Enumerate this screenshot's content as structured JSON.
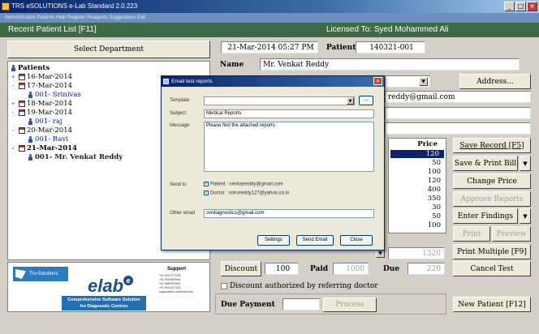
{
  "window": {
    "title": "TRS eSOLUTIONS e-Lab Standard 2.0.223"
  },
  "menubar": {
    "text": "Administration  Patients  Help  Register Reagents  Suggestions  Exit"
  },
  "header": {
    "left": "Recent Patient List [F11]",
    "right": "Licensed To: Syed Mohammed Ali"
  },
  "left_panel": {
    "select_department": "Select Department",
    "tree": [
      {
        "type": "root",
        "label": "Patients"
      },
      {
        "type": "date",
        "label": "16-Mar-2014",
        "bold": false
      },
      {
        "type": "date",
        "label": "17-Mar-2014",
        "bold": false
      },
      {
        "type": "patient",
        "label": "001- Srinivas"
      },
      {
        "type": "date",
        "label": "18-Mar-2014",
        "bold": false
      },
      {
        "type": "date",
        "label": "19-Mar-2014",
        "bold": false
      },
      {
        "type": "patient",
        "label": "001- raj"
      },
      {
        "type": "date",
        "label": "20-Mar-2014",
        "bold": false
      },
      {
        "type": "patient",
        "label": "001- Ravi"
      },
      {
        "type": "date",
        "label": "21-Mar-2014",
        "bold": true
      },
      {
        "type": "patient",
        "label": "001- Mr. Venkat Reddy"
      }
    ],
    "logo": {
      "brand": "Tru-Solutions",
      "product": "elab",
      "product_mark": "e",
      "tagline_1": "Comprehensive Software Solution",
      "tagline_2": "for Diagnostic Centres",
      "support_title": "Support",
      "support_lines": [
        "+91 9014770725",
        "+91 9394590944",
        "+91 9869370500",
        "+91 9014477244",
        "support@tru-solutions.com"
      ]
    }
  },
  "patient": {
    "datetime": "21-Mar-2014 05:27 PM",
    "patient_id_label": "Patient Id",
    "patient_id": "140321-001",
    "name_label": "Name",
    "name": "Mr. Venkat Reddy",
    "email_visible": "reddy@gmail.com",
    "address_button": "Address..."
  },
  "tests": {
    "price_header": "Price",
    "prices": [
      "120",
      "50",
      "100",
      "120",
      "400",
      "350",
      "30",
      "50",
      "100"
    ],
    "right_value": "1320"
  },
  "actions": {
    "save_record": "Save Record [F5]",
    "save_print_bill": "Save & Print Bill",
    "change_price": "Change Price",
    "approve_reports": "Approve Reports",
    "enter_findings": "Enter Findings",
    "print": "Print",
    "preview": "Preview",
    "print_multiple": "Print Multiple [F9]",
    "cancel_test": "Cancel Test",
    "new_patient": "New Patient [F12]"
  },
  "billing": {
    "discount_label": "Discount",
    "discount_value": "100",
    "paid_label": "Paid",
    "paid_value": "1000",
    "due_label": "Due",
    "due_value": "220",
    "discount_auth": "Discount authorized by referring doctor",
    "due_payment_label": "Due Payment",
    "process_button": "Process"
  },
  "email_dialog": {
    "title": "Email test reports",
    "template_label": "Template",
    "browse": "...",
    "subject_label": "Subject",
    "subject_value": "Medical Reports",
    "message_label": "Message",
    "message_value": "Please find the attached reports",
    "send_to_label": "Send to",
    "patient_option": "Patient : venkatreddy@gmail.com",
    "doctor_option": "Doctor : srinureddy127@yahoo.co.in",
    "other_email_label": "Other email",
    "other_email_value": "svrdiagnostics@gmail.com",
    "settings": "Settings",
    "send_email": "Send Email",
    "close": "Close"
  }
}
